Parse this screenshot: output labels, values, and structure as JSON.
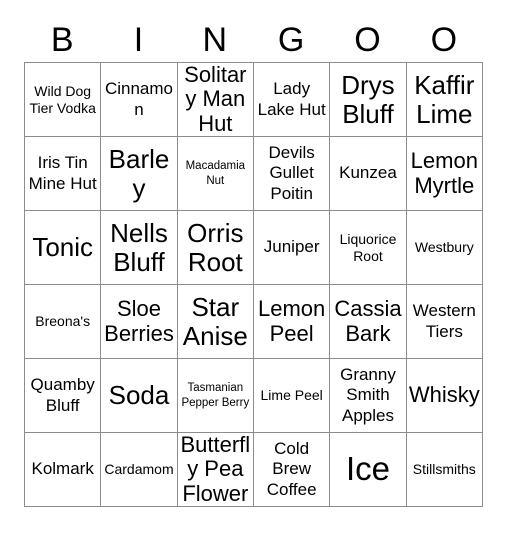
{
  "card": {
    "headers": [
      "B",
      "I",
      "N",
      "G",
      "O",
      "O"
    ],
    "rows": [
      [
        {
          "text": "Wild Dog Tier Vodka",
          "size": "sm"
        },
        {
          "text": "Cinnamon",
          "size": "md"
        },
        {
          "text": "Solitary Man Hut",
          "size": "lg"
        },
        {
          "text": "Lady Lake Hut",
          "size": "md"
        },
        {
          "text": "Drys Bluff",
          "size": "xl"
        },
        {
          "text": "Kaffir Lime",
          "size": "xl"
        }
      ],
      [
        {
          "text": "Iris Tin Mine Hut",
          "size": "md"
        },
        {
          "text": "Barley",
          "size": "xl"
        },
        {
          "text": "Macadamia Nut",
          "size": "xs"
        },
        {
          "text": "Devils Gullet Poitin",
          "size": "md"
        },
        {
          "text": "Kunzea",
          "size": "md"
        },
        {
          "text": "Lemon Myrtle",
          "size": "lg"
        }
      ],
      [
        {
          "text": "Tonic",
          "size": "xl"
        },
        {
          "text": "Nells Bluff",
          "size": "xl"
        },
        {
          "text": "Orris Root",
          "size": "xl"
        },
        {
          "text": "Juniper",
          "size": "md"
        },
        {
          "text": "Liquorice Root",
          "size": "sm"
        },
        {
          "text": "Westbury",
          "size": "sm"
        }
      ],
      [
        {
          "text": "Breona's",
          "size": "sm"
        },
        {
          "text": "Sloe Berries",
          "size": "lg"
        },
        {
          "text": "Star Anise",
          "size": "xl"
        },
        {
          "text": "Lemon Peel",
          "size": "lg"
        },
        {
          "text": "Cassia Bark",
          "size": "lg"
        },
        {
          "text": "Western Tiers",
          "size": "md"
        }
      ],
      [
        {
          "text": "Quamby Bluff",
          "size": "md"
        },
        {
          "text": "Soda",
          "size": "xl"
        },
        {
          "text": "Tasmanian Pepper Berry",
          "size": "xs"
        },
        {
          "text": "Lime Peel",
          "size": "sm"
        },
        {
          "text": "Granny Smith Apples",
          "size": "md"
        },
        {
          "text": "Whisky",
          "size": "lg"
        }
      ],
      [
        {
          "text": "Kolmark",
          "size": "md"
        },
        {
          "text": "Cardamom",
          "size": "sm"
        },
        {
          "text": "Butterfly Pea Flower",
          "size": "lg"
        },
        {
          "text": "Cold Brew Coffee",
          "size": "md"
        },
        {
          "text": "Ice",
          "size": "xxl"
        },
        {
          "text": "Stillsmiths",
          "size": "sm"
        }
      ]
    ],
    "colors": {
      "border": "#8c8c8c",
      "text": "#000000",
      "background": "#ffffff"
    }
  }
}
